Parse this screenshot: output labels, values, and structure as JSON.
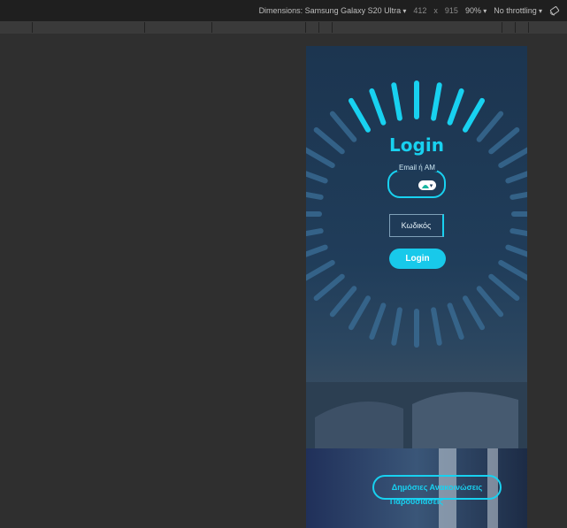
{
  "devtools": {
    "dimensions_label": "Dimensions: Samsung Galaxy S20 Ultra",
    "width": "412",
    "times": "x",
    "height": "915",
    "zoom": "90%",
    "throttling": "No throttling"
  },
  "login": {
    "title": "Login",
    "email_label": "Email ή AM",
    "password_placeholder": "Κωδικός",
    "login_button": "Login"
  },
  "footer": {
    "announcements_button": "Δημόσιες Ανακοινώσεις",
    "presentations_text": "Παρουσιάσεις"
  },
  "colors": {
    "accent": "#18d1f0",
    "background": "#1c3550"
  },
  "icons": {
    "rotate": "rotate-icon",
    "badge": "autofill-badge-icon"
  }
}
